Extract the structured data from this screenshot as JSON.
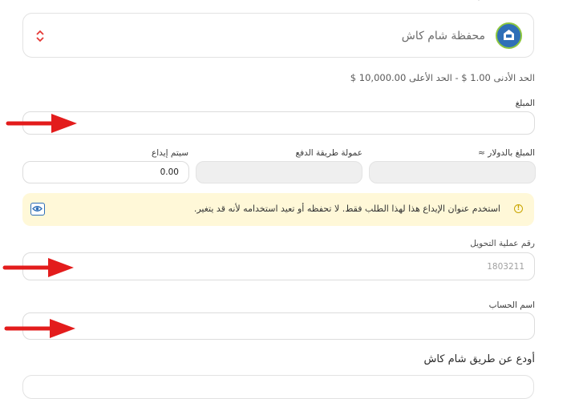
{
  "wallet_select": {
    "name": "محفظة شام كاش",
    "logo": "wallet-logo-icon",
    "indicator": "sort-arrows-icon"
  },
  "limits": {
    "min_label": "الحد الأدنى",
    "min_value": "1.00 $",
    "separator": "-",
    "max_label": "الحد الأعلى",
    "max_value": "10,000.00 $"
  },
  "amount": {
    "label": "المبلغ",
    "value": ""
  },
  "usd_amount": {
    "label": "المبلغ بالدولار ≈",
    "value": ""
  },
  "fee": {
    "label": "عمولة طريقة الدفع",
    "value": ""
  },
  "deposit": {
    "label": "سيتم إيداع",
    "value": "0.00"
  },
  "notice": {
    "text": "استخدم عنوان الإيداع هذا لهذا الطلب فقط. لا تحفظه أو تعيد استخدامه لأنه قد يتغير.",
    "icon": "info-icon",
    "action_icon": "eye-icon"
  },
  "transfer": {
    "label": "رقم عملية التحويل",
    "placeholder": "1803211"
  },
  "account_name": {
    "label": "اسم الحساب",
    "value": ""
  },
  "section": {
    "title": "أودع عن طريق شام كاش"
  },
  "colors": {
    "accent_blue": "#2f6fb7",
    "notice_bg": "#fff8d8",
    "annotation_red": "#e31c1c",
    "indicator_red": "#e53935"
  }
}
